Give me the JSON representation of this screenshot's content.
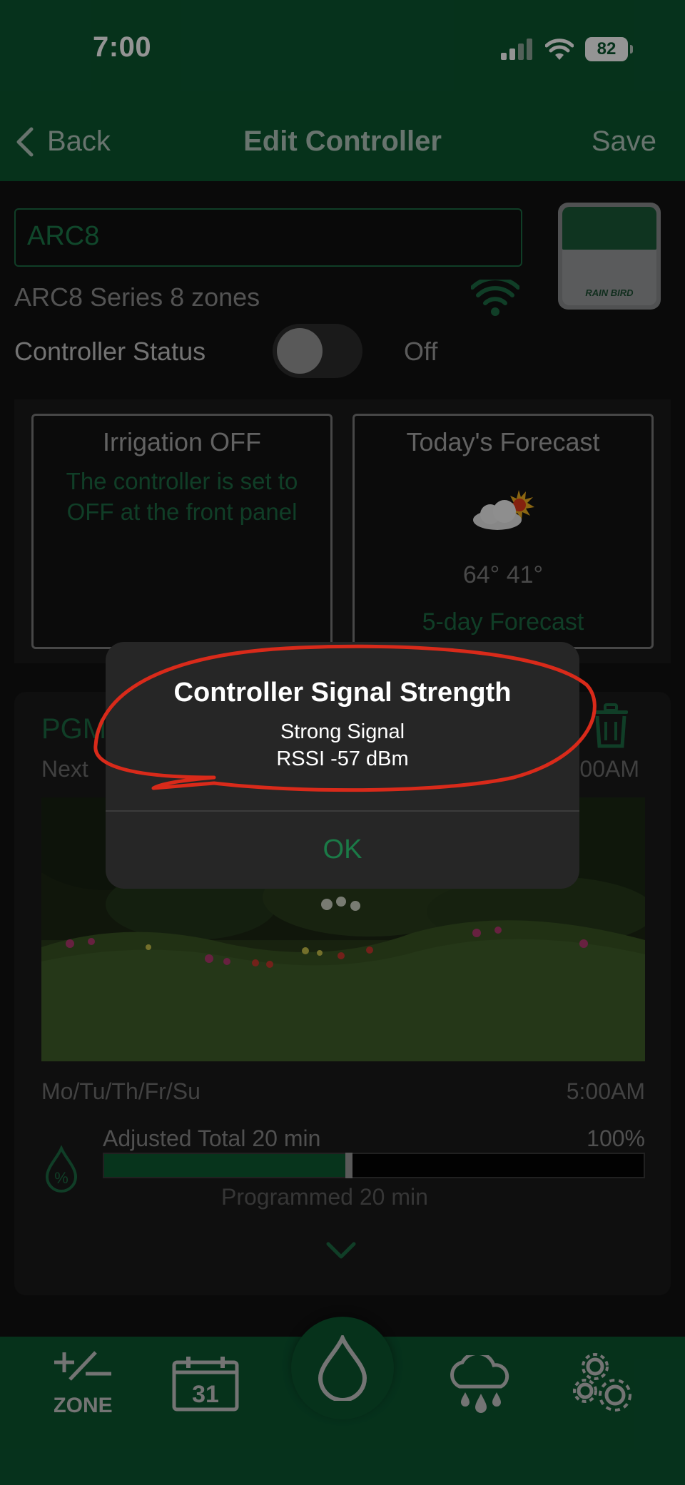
{
  "status_bar": {
    "time": "7:00",
    "battery": "82"
  },
  "nav": {
    "back": "Back",
    "title": "Edit Controller",
    "save": "Save"
  },
  "controller": {
    "name": "ARC8",
    "series": "ARC8 Series  8 zones",
    "image_brand": "RAIN BIRD",
    "status_label": "Controller Status",
    "status_value": "Off"
  },
  "cards": {
    "irrigation": {
      "title": "Irrigation OFF",
      "message": "The controller is set to OFF at the front panel"
    },
    "forecast": {
      "title": "Today's Forecast",
      "temps": "64° 41°",
      "link": "5-day Forecast"
    }
  },
  "program": {
    "title": "PGM",
    "next_label": "Next",
    "next_time": "00AM",
    "days": "Mo/Tu/Th/Fr/Su",
    "start_time": "5:00AM",
    "adjusted_label": "Adjusted Total    20 min",
    "adjusted_percent": "100%",
    "programmed_label": "Programmed    20 min",
    "progress_fraction": 0.45
  },
  "alert": {
    "title": "Controller Signal Strength",
    "line1": "Strong Signal",
    "line2": "RSSI -57 dBm",
    "ok": "OK"
  },
  "tabs": {
    "zone_label": "ZONE",
    "calendar_day": "31"
  },
  "colors": {
    "brand_green": "#0b5630",
    "accent_green": "#1d6c44",
    "annotation_red": "#d92a1a"
  }
}
